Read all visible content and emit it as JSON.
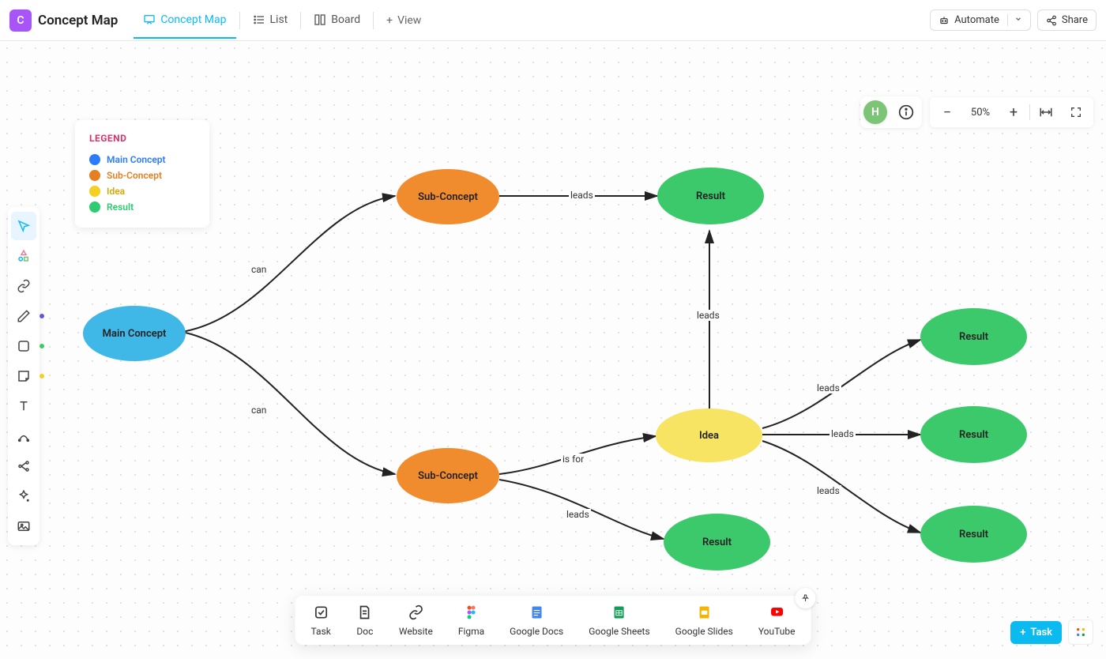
{
  "app": {
    "icon_letter": "C",
    "title": "Concept Map"
  },
  "views": {
    "concept_map": "Concept Map",
    "list": "List",
    "board": "Board",
    "add": "View"
  },
  "topbar": {
    "automate": "Automate",
    "share": "Share"
  },
  "user": {
    "initial": "H"
  },
  "zoom": {
    "value": "50%"
  },
  "legend": {
    "title": "LEGEND",
    "items": [
      {
        "label": "Main Concept",
        "color": "#2b7bff"
      },
      {
        "label": "Sub-Concept",
        "color": "#e67e22"
      },
      {
        "label": "Idea",
        "color": "#f5d020"
      },
      {
        "label": "Result",
        "color": "#2ecc71"
      }
    ]
  },
  "nodes": {
    "main": "Main Concept",
    "sub1": "Sub-Concept",
    "sub2": "Sub-Concept",
    "idea": "Idea",
    "result_top": "Result",
    "result_bottom": "Result",
    "result_r1": "Result",
    "result_r2": "Result",
    "result_r3": "Result"
  },
  "edges": {
    "can1": "can",
    "can2": "can",
    "leads1": "leads",
    "leads2": "leads",
    "isfor": "is for",
    "leads3": "leads",
    "leads4": "leads",
    "leads5": "leads",
    "leads6": "leads"
  },
  "dock": {
    "task": "Task",
    "doc": "Doc",
    "website": "Website",
    "figma": "Figma",
    "gdocs": "Google Docs",
    "gsheets": "Google Sheets",
    "gslides": "Google Slides",
    "youtube": "YouTube"
  },
  "actions": {
    "task_btn": "Task"
  },
  "colors": {
    "main": "#3fb8e8",
    "sub": "#f08c2e",
    "idea": "#f7e463",
    "result": "#3cc96b"
  }
}
